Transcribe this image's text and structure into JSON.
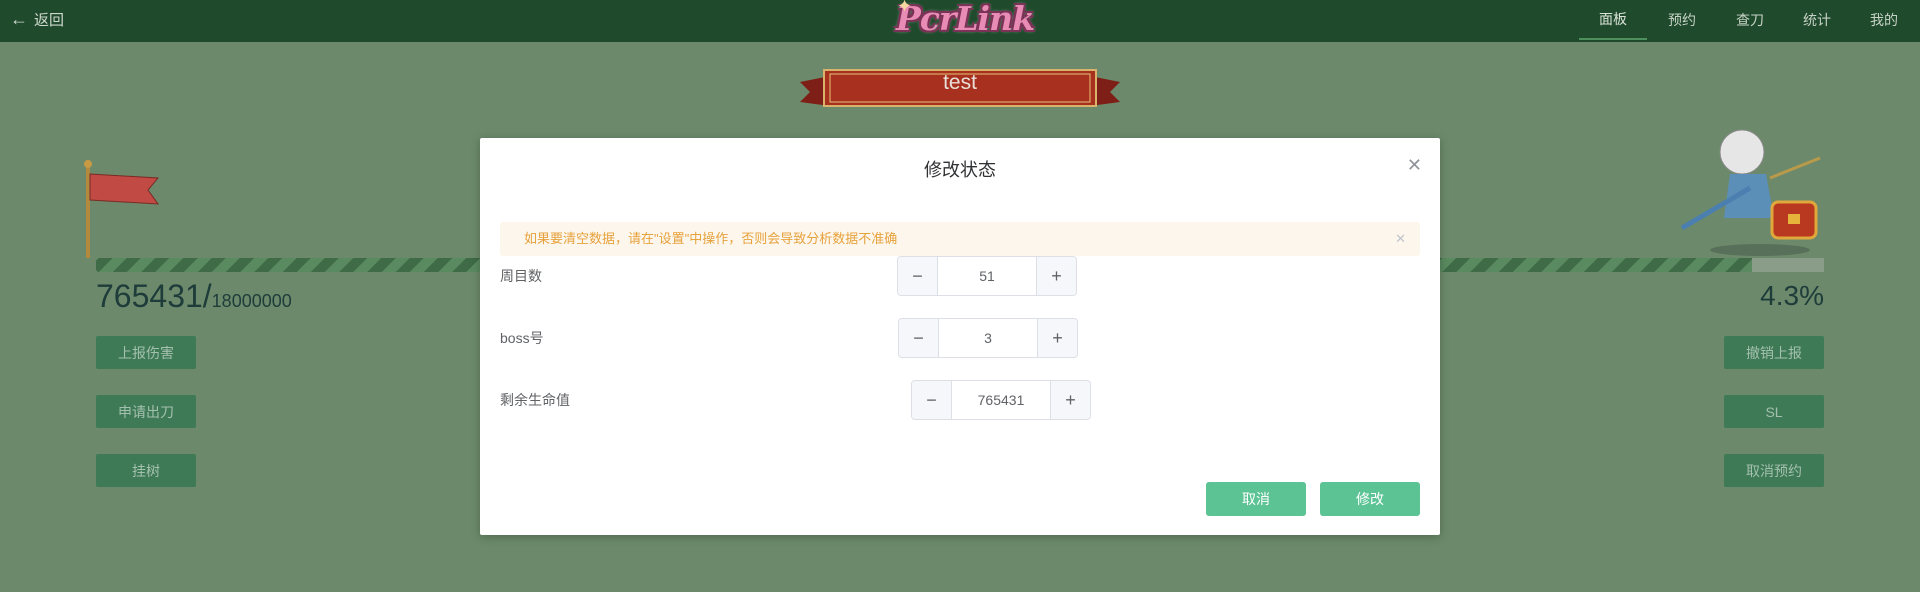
{
  "topbar": {
    "back_label": "返回",
    "logo_text": "PcrLink",
    "nav": [
      {
        "label": "面板",
        "active": true
      },
      {
        "label": "预约",
        "active": false
      },
      {
        "label": "查刀",
        "active": false
      },
      {
        "label": "统计",
        "active": false
      },
      {
        "label": "我的",
        "active": false
      }
    ]
  },
  "page": {
    "banner_title": "test",
    "hp_current": "765431/",
    "hp_max": "18000000",
    "hp_percent": "4.3%",
    "progress_fraction": 0.957,
    "left_buttons": [
      "上报伤害",
      "申请出刀",
      "挂树"
    ],
    "right_buttons": [
      "撤销上报",
      "SL",
      "取消预约"
    ]
  },
  "modal": {
    "title": "修改状态",
    "alert": "如果要清空数据，请在\"设置\"中操作，否则会导致分析数据不准确",
    "fields": [
      {
        "label": "周目数",
        "value": "51"
      },
      {
        "label": "boss号",
        "value": "3"
      },
      {
        "label": "剩余生命值",
        "value": "765431"
      }
    ],
    "cancel_label": "取消",
    "confirm_label": "修改"
  },
  "icons": {
    "back": "arrow-left-icon",
    "close": "close-icon",
    "minus": "minus-icon",
    "plus": "plus-icon"
  },
  "colors": {
    "topbar": "#1f4a2b",
    "overlay_background": "#6c8a6b",
    "primary_button": "#5cc395",
    "alert_text": "#e6a23c",
    "alert_background": "#fdf6ec"
  }
}
